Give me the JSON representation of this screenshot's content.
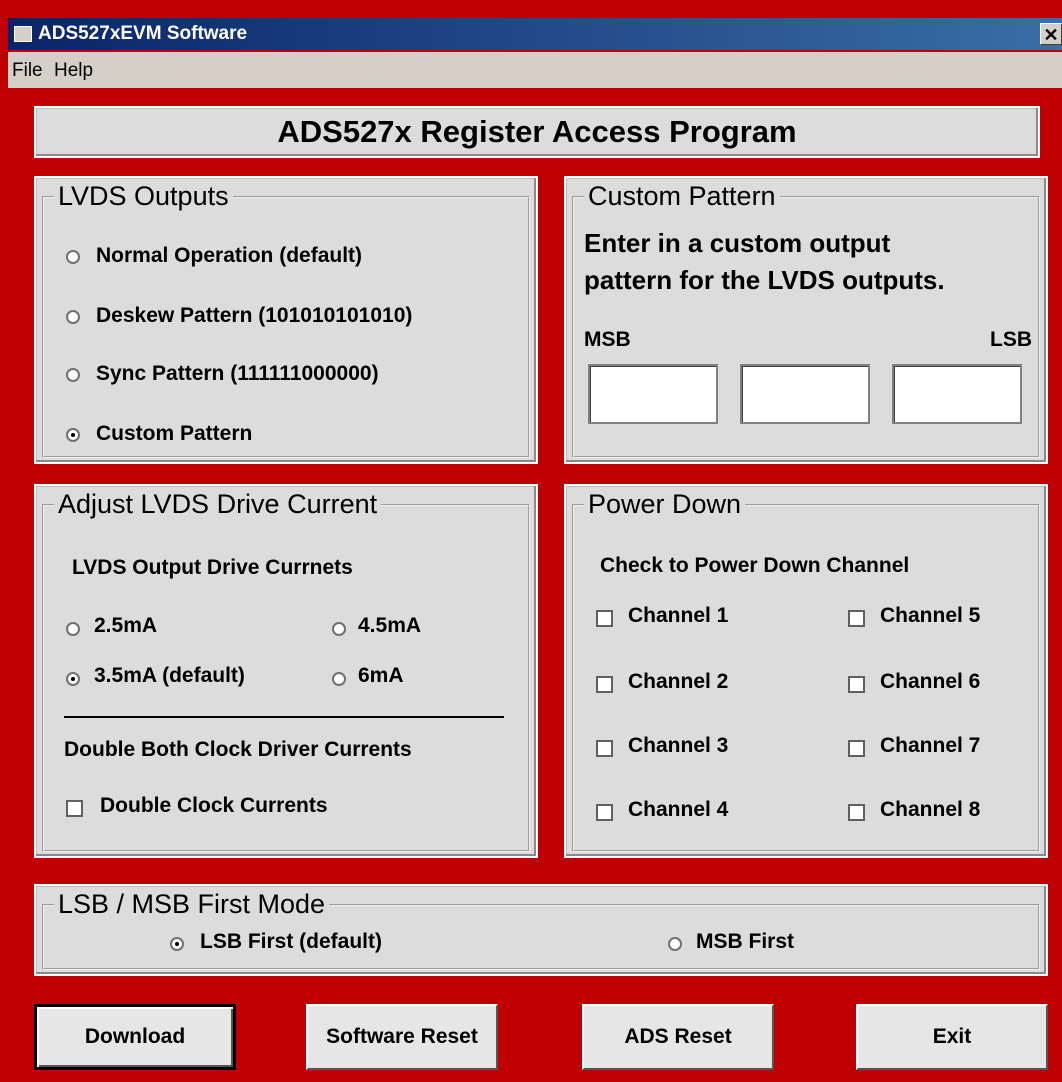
{
  "window": {
    "title": "ADS527xEVM Software",
    "close_glyph": "✕"
  },
  "menu": {
    "items": [
      "File",
      "Help"
    ]
  },
  "header": {
    "title": "ADS527x Register Access Program"
  },
  "lvds_outputs": {
    "title": "LVDS Outputs",
    "options": [
      {
        "label": "Normal Operation (default)",
        "selected": false
      },
      {
        "label": "Deskew Pattern  (101010101010)",
        "selected": false
      },
      {
        "label": "Sync Pattern  (111111000000)",
        "selected": false
      },
      {
        "label": "Custom Pattern",
        "selected": true
      }
    ]
  },
  "custom_pattern": {
    "title": "Custom Pattern",
    "instructions_line1": "Enter in a custom output",
    "instructions_line2": "pattern for the LVDS outputs.",
    "msb_label": "MSB",
    "lsb_label": "LSB",
    "fields": [
      "",
      "",
      ""
    ]
  },
  "drive_current": {
    "title": "Adjust LVDS Drive Current",
    "subtitle": "LVDS Output Drive Currnets",
    "options": [
      {
        "label": "2.5mA",
        "selected": false
      },
      {
        "label": "4.5mA",
        "selected": false
      },
      {
        "label": "3.5mA (default)",
        "selected": true
      },
      {
        "label": "6mA",
        "selected": false
      }
    ],
    "double_heading": "Double Both Clock Driver Currents",
    "double_checkbox": "Double Clock Currents"
  },
  "power_down": {
    "title": "Power Down",
    "subtitle": "Check to Power Down Channel",
    "channels": [
      "Channel 1",
      "Channel 2",
      "Channel 3",
      "Channel 4",
      "Channel 5",
      "Channel 6",
      "Channel 7",
      "Channel 8"
    ]
  },
  "first_mode": {
    "title": "LSB / MSB First Mode",
    "options": [
      {
        "label": "LSB First (default)",
        "selected": true
      },
      {
        "label": "MSB First",
        "selected": false
      }
    ]
  },
  "buttons": {
    "download": "Download",
    "software_reset": "Software Reset",
    "ads_reset": "ADS Reset",
    "exit": "Exit"
  }
}
